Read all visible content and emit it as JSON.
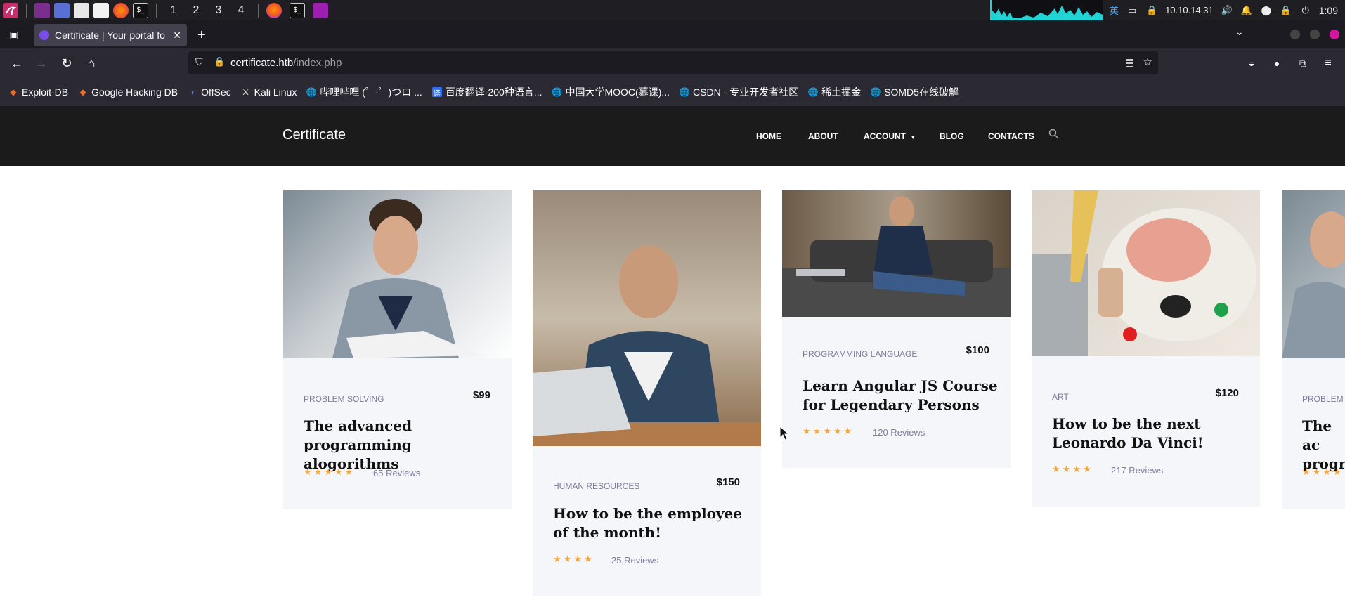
{
  "taskbar": {
    "workspaces": [
      "1",
      "2",
      "3",
      "4"
    ],
    "ip": "10.10.14.31",
    "lang": "英",
    "time": "1:09"
  },
  "browser": {
    "tab_title": "Certificate | Your portal fo",
    "url_host": "certificate.htb",
    "url_path": "/index.php",
    "bookmarks": [
      {
        "label": "Exploit-DB",
        "icon": "exploitdb-icon"
      },
      {
        "label": "Google Hacking DB",
        "icon": "ghdb-icon"
      },
      {
        "label": "OffSec",
        "icon": "offsec-icon"
      },
      {
        "label": "Kali Linux",
        "icon": "kali-icon"
      },
      {
        "label": "哔哩哔哩 (゜-゜)つロ ...",
        "icon": "globe-icon"
      },
      {
        "label": "百度翻译-200种语言...",
        "icon": "baidu-translate-icon"
      },
      {
        "label": "中国大学MOOC(慕课)...",
        "icon": "globe-icon"
      },
      {
        "label": "CSDN - 专业开发者社区",
        "icon": "globe-icon"
      },
      {
        "label": "稀土掘金",
        "icon": "globe-icon"
      },
      {
        "label": "SOMD5在线破解",
        "icon": "globe-icon"
      }
    ]
  },
  "site": {
    "brand": "Certificate",
    "menu": [
      "HOME",
      "ABOUT",
      "ACCOUNT",
      "BLOG",
      "CONTACTS"
    ]
  },
  "cards": [
    {
      "category": "PROBLEM SOLVING",
      "price": "$99",
      "title": "The advanced programming alogorithms",
      "stars": 5,
      "reviews": "65 Reviews"
    },
    {
      "category": "HUMAN RESOURCES",
      "price": "$150",
      "title": "How to be the employee of the month!",
      "stars": 4,
      "reviews": "25 Reviews"
    },
    {
      "category": "PROGRAMMING LANGUAGE",
      "price": "$100",
      "title": "Learn Angular JS Course for Legendary Persons",
      "stars": 5,
      "reviews": "120 Reviews"
    },
    {
      "category": "ART",
      "price": "$120",
      "title": "How to be the next Leonardo Da Vinci!",
      "stars": 4,
      "reviews": "217 Reviews"
    },
    {
      "category": "PROBLEM S",
      "price": "",
      "title": "The ac progra",
      "stars": 4,
      "reviews": ""
    }
  ],
  "colors": {
    "header_bg": "#1b1b1b",
    "card_bg": "#f5f6fa",
    "star": "#f3a63a",
    "category": "#7a7d9c"
  }
}
